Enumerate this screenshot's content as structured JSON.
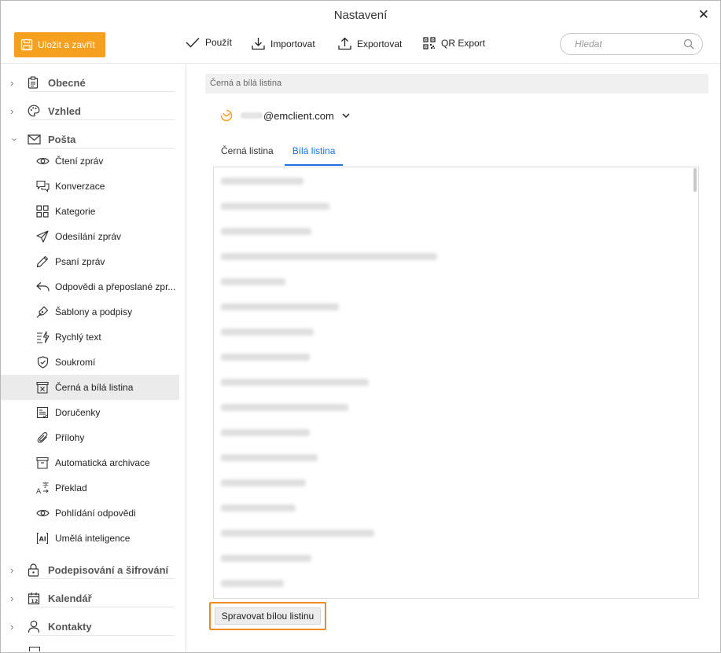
{
  "window": {
    "title": "Nastavení",
    "close_glyph": "✕"
  },
  "toolbar": {
    "save_label": "Uložit a zavřít",
    "apply_label": "Použít",
    "import_label": "Importovat",
    "export_label": "Exportovat",
    "qr_label": "QR Export",
    "search_placeholder": "Hledat"
  },
  "sidebar": {
    "groups": [
      {
        "label": "Obecné",
        "icon": "clipboard-icon",
        "expanded": false
      },
      {
        "label": "Vzhled",
        "icon": "palette-icon",
        "expanded": false
      },
      {
        "label": "Pošta",
        "icon": "envelope-icon",
        "expanded": true
      },
      {
        "label": "Podepisování a šifrování",
        "icon": "lock-icon",
        "expanded": false
      },
      {
        "label": "Kalendář",
        "icon": "calendar-icon",
        "expanded": false
      },
      {
        "label": "Kontakty",
        "icon": "person-icon",
        "expanded": false
      }
    ],
    "mail_items": [
      {
        "label": "Čtení zpráv",
        "icon": "eye-icon"
      },
      {
        "label": "Konverzace",
        "icon": "chat-bubbles-icon"
      },
      {
        "label": "Kategorie",
        "icon": "grid-icon"
      },
      {
        "label": "Odesílání zpráv",
        "icon": "paper-plane-icon"
      },
      {
        "label": "Psaní zpráv",
        "icon": "pencil-icon"
      },
      {
        "label": "Odpovědi a přeposlané zpr...",
        "icon": "reply-icon"
      },
      {
        "label": "Šablony a podpisy",
        "icon": "pen-nib-icon"
      },
      {
        "label": "Rychlý text",
        "icon": "quick-text-icon"
      },
      {
        "label": "Soukromí",
        "icon": "shield-icon"
      },
      {
        "label": "Černá a bílá listina",
        "icon": "blocklist-icon",
        "active": true
      },
      {
        "label": "Doručenky",
        "icon": "receipt-icon"
      },
      {
        "label": "Přílohy",
        "icon": "paperclip-icon"
      },
      {
        "label": "Automatická archivace",
        "icon": "archive-box-icon"
      },
      {
        "label": "Překlad",
        "icon": "translate-icon"
      },
      {
        "label": "Pohlídání odpovědi",
        "icon": "eye-icon"
      },
      {
        "label": "Umělá inteligence",
        "icon": "ai-icon"
      }
    ]
  },
  "content": {
    "section_title": "Černá a bílá listina",
    "account_domain": "@emclient.com",
    "tabs": [
      {
        "label": "Černá listina",
        "active": false
      },
      {
        "label": "Bílá listina",
        "active": true
      }
    ],
    "manage_button": "Spravovat bílou listinu"
  },
  "colors": {
    "accent_orange": "#f5a01e",
    "tab_active_blue": "#1a73e8",
    "highlight_orange": "#f08a1c",
    "active_item_bg": "#ebebeb"
  }
}
